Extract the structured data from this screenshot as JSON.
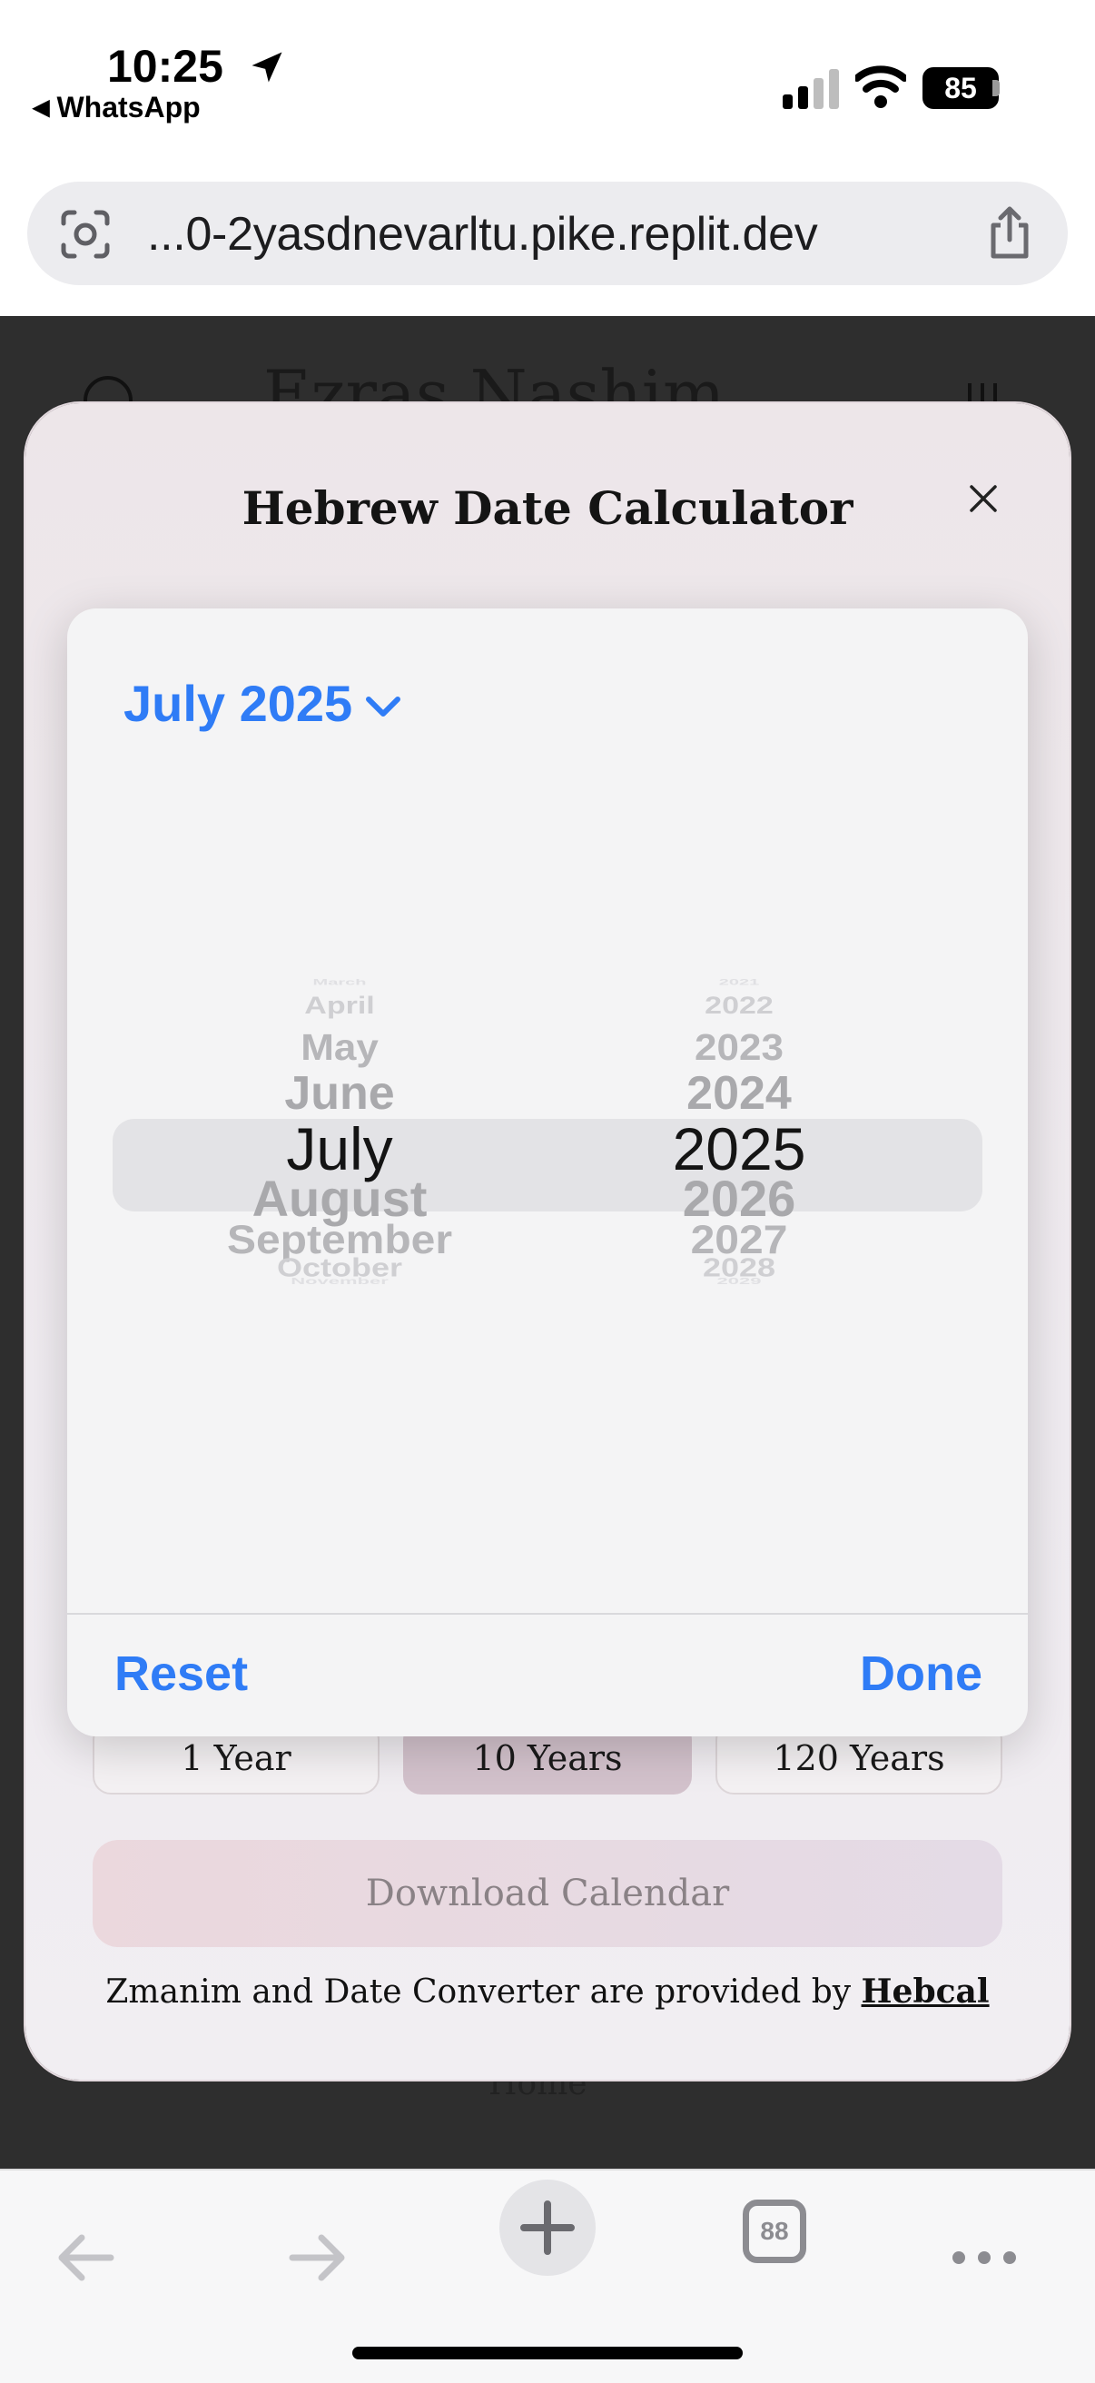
{
  "status_bar": {
    "time": "10:25",
    "back_app": "WhatsApp",
    "battery": "85"
  },
  "browser": {
    "url": "...0-2yasdnevarltu.pike.replit.dev",
    "tab_count": "88"
  },
  "background": {
    "site_title": "Ezras Nashim",
    "nav_label": "Home"
  },
  "modal": {
    "title": "Hebrew Date Calculator",
    "ranges": [
      "1 Year",
      "10 Years",
      "120 Years"
    ],
    "download_label": "Download Calendar",
    "credit_text": "Zmanim and Date Converter are provided by",
    "credit_link": "Hebcal"
  },
  "picker": {
    "header": "July 2025",
    "months": [
      "March",
      "April",
      "May",
      "June",
      "July",
      "August",
      "September",
      "October",
      "November"
    ],
    "years": [
      "2021",
      "2022",
      "2023",
      "2024",
      "2025",
      "2026",
      "2027",
      "2028",
      "2029"
    ],
    "selected_month": "July",
    "selected_year": "2025",
    "reset_label": "Reset",
    "done_label": "Done"
  },
  "colors": {
    "accent": "#2f7cf6",
    "active_range": "#d3c2cc"
  }
}
